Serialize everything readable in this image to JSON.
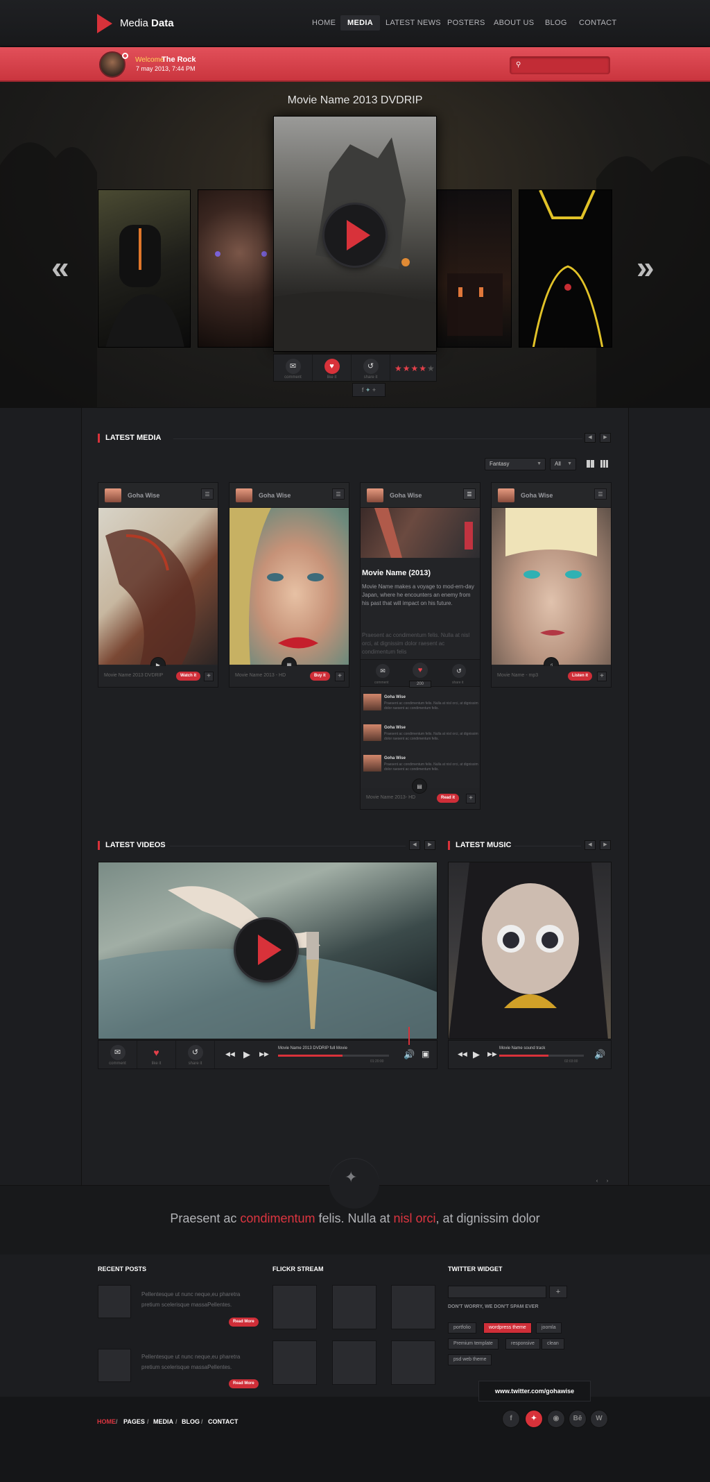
{
  "brand": {
    "name_light": "Media",
    "name_bold": "Data"
  },
  "nav": [
    {
      "label": "HOME"
    },
    {
      "label": "MEDIA"
    },
    {
      "label": "LATEST NEWS"
    },
    {
      "label": "POSTERS"
    },
    {
      "label": "ABOUT US"
    },
    {
      "label": "BLOG"
    },
    {
      "label": "CONTACT"
    }
  ],
  "user": {
    "welcome": "Welcome",
    "name": "The Rock",
    "date": "7 may 2013,  7:44 PM"
  },
  "hero": {
    "title": "Movie Name 2013 DVDRIP",
    "actions": [
      {
        "label": "comment",
        "icon": "comment-icon"
      },
      {
        "label": "like it",
        "icon": "heart-icon"
      },
      {
        "label": "share it",
        "icon": "share-icon"
      }
    ],
    "rating_stars": 4
  },
  "latest_media": {
    "title": "LATEST MEDIA",
    "filters": {
      "genre": "Fantasy",
      "type": "All"
    },
    "cards": [
      {
        "author": "Goha Wise",
        "caption": "Movie Name  2013  DVDRIP",
        "button": "Watch it",
        "icon": "play-icon"
      },
      {
        "author": "Goha Wise",
        "caption": "Movie Name 2013 - HD",
        "button": "Buy it",
        "icon": "film-icon"
      },
      {
        "author": "Goha Wise",
        "caption": "Movie Name  2013- HD",
        "button": "Read it",
        "icon": "document-icon",
        "title": "Movie Name (2013)",
        "text1": "Movie Name makes a voyage to mod-ern-day Japan, where he encounters an enemy from his past that will impact on his future.",
        "text2": "Praesent ac condimentum felis. Nulla at nisl orci, at dignissim dolor raesent ac condimentum felis",
        "actions": [
          {
            "label": "comment"
          },
          {
            "label": "share it"
          }
        ],
        "likes": "200",
        "comments": [
          {
            "name": "Goha Wise",
            "text": "Praesent ac condimentum felis. Nulla at nisl orci, at dignissim dolor raesent ac condimentum felis."
          },
          {
            "name": "Goha Wise",
            "text": "Praesent ac condimentum felis. Nulla at nisl orci, at dignissim dolor raesent ac condimentum felis."
          },
          {
            "name": "Goha Wise",
            "text": "Praesent ac condimentum felis. Nulla at nisl orci, at dignissim dolor raesent ac condimentum felis."
          }
        ]
      },
      {
        "author": "Goha Wise",
        "caption": "Movie Name - mp3",
        "button": "Listen it",
        "icon": "music-icon"
      }
    ]
  },
  "latest_videos": {
    "title": "LATEST VIDEOS",
    "actions": [
      {
        "label": "comment"
      },
      {
        "label": "like it"
      },
      {
        "label": "share it"
      }
    ],
    "track": "Movie Name  2013  DVDRIP  full Movie",
    "time": "01:20:00",
    "progress": 0.58
  },
  "latest_music": {
    "title": "LATEST MUSIC",
    "track": "Movie Name sound track",
    "time": "02:03:00",
    "progress": 0.58
  },
  "quote": {
    "p1": "Praesent ac ",
    "h1": "condimentum",
    "p2": " felis. Nulla at ",
    "h2": "nisl orci",
    "p3": ", at dignissim dolor"
  },
  "footer": {
    "recent_posts": {
      "title": "RECENT POSTS",
      "posts": [
        {
          "text": "Pellentesque ut nunc neque,eu pharetra pretium scelerisque massaPellentes.",
          "button": "Read More"
        },
        {
          "text": "Pellentesque ut nunc neque,eu pharetra pretium scelerisque massaPellentes.",
          "button": "Read More"
        }
      ]
    },
    "flickr": {
      "title": "FLICKR STREAM"
    },
    "twitter": {
      "title": "TWITTER WIDGET",
      "note": "DON'T WORRY, WE DON'T SPAM EVER",
      "tags": [
        "portfolio",
        "wordpress theme",
        "joomla",
        "Premium template",
        "responsive",
        "clean",
        "psd web theme"
      ],
      "link": "www.twitter.com/gohawise"
    }
  },
  "bottom_nav": [
    "HOME",
    "PAGES",
    "MEDIA",
    "BLOG",
    "CONTACT"
  ],
  "social": [
    "facebook-icon",
    "twitter-icon",
    "dribbble-icon",
    "behance-icon",
    "wordpress-icon"
  ],
  "colors": {
    "accent": "#d8323a",
    "background": "#1c1d20"
  }
}
